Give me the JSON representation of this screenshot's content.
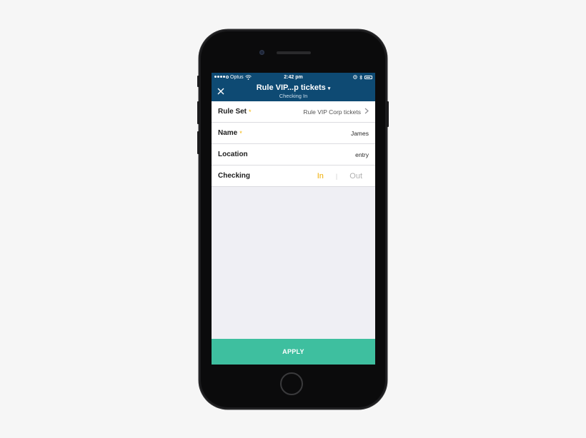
{
  "status_bar": {
    "carrier": "Optus",
    "time": "2:42 pm",
    "wifi_icon": "wifi-icon",
    "alarm_icon": "alarm-icon",
    "bluetooth_icon": "bluetooth-icon",
    "battery_icon": "battery-icon"
  },
  "nav": {
    "close_icon": "close-icon",
    "title": "Rule VIP...p tickets",
    "title_caret": "▾",
    "subtitle": "Checking In"
  },
  "form": {
    "rule_set": {
      "label": "Rule Set",
      "required": "*",
      "value": "Rule VIP Corp tickets",
      "chevron": "›"
    },
    "name": {
      "label": "Name",
      "required": "*",
      "value": "James"
    },
    "location": {
      "label": "Location",
      "value": "entry"
    },
    "checking": {
      "label": "Checking",
      "option_in": "In",
      "separator": "|",
      "option_out": "Out",
      "selected": "In"
    }
  },
  "apply_label": "APPLY",
  "colors": {
    "nav_bg": "#0e4a73",
    "accent_yellow": "#f0ad00",
    "apply_green": "#3ebf9f"
  }
}
